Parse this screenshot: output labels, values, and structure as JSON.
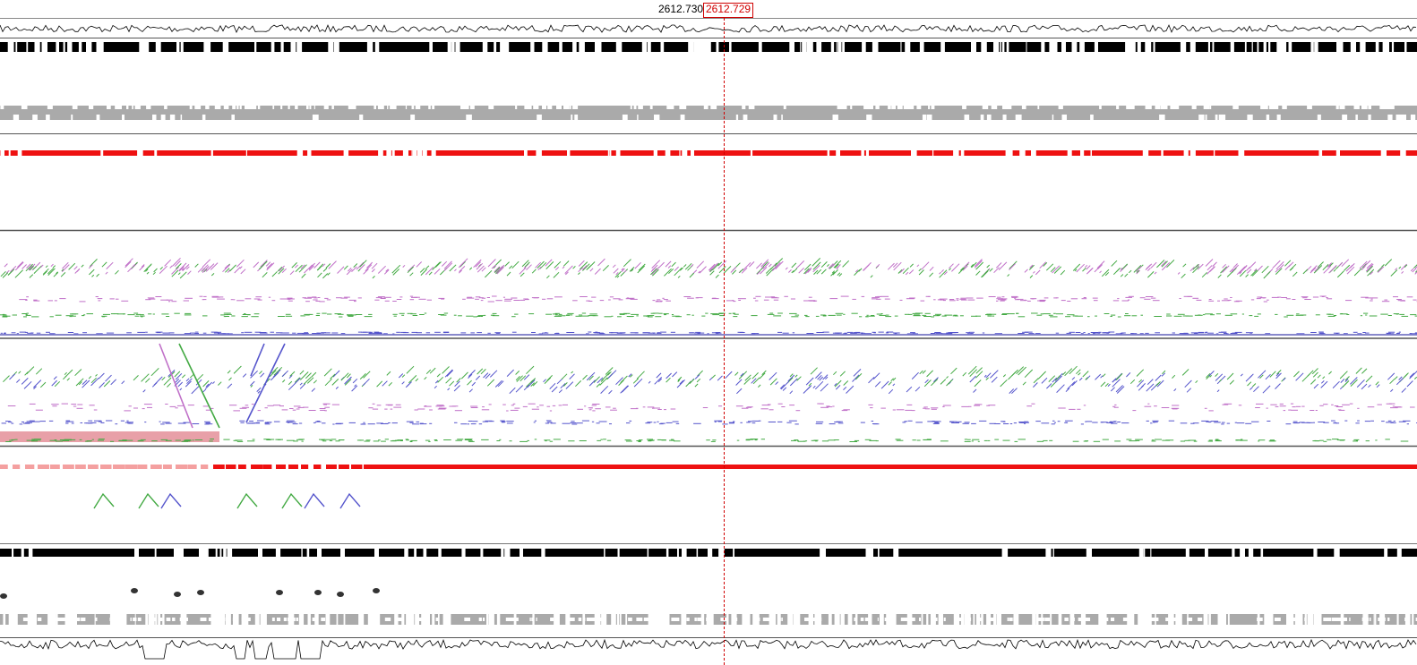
{
  "header": {
    "coord_left": "2612.730",
    "coord_right": "2612.729"
  },
  "colors": {
    "background": "#ffffff",
    "feature_black": "#000000",
    "feature_gray": "#aaaaaa",
    "feature_red": "#ee1111",
    "hit_pink": "#e8a0a8",
    "hit_magenta": "#c070c8",
    "hit_green": "#44aa44",
    "hit_blue": "#5555cc",
    "cursor_line": "#d00000"
  },
  "tracks": [
    "graph-top",
    "black-feature-band-top",
    "gray-feature-band-top",
    "red-feature-band-top",
    "hits-forward",
    "hits-reverse",
    "red-feature-band-bottom",
    "black-feature-band-bottom",
    "gray-feature-band-bottom",
    "graph-bottom"
  ]
}
